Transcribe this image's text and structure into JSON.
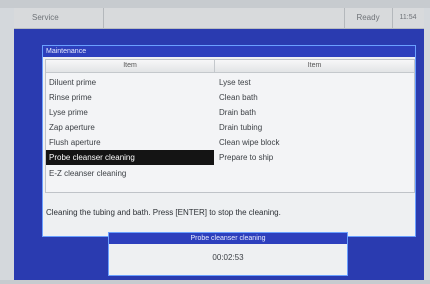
{
  "topbar": {
    "mode": "Service",
    "status": "Ready",
    "clock": "11:54"
  },
  "window": {
    "title": "Maintenance",
    "columns": [
      "Item",
      "Item"
    ],
    "left_items": [
      "Diluent prime",
      "Rinse prime",
      "Lyse prime",
      "Zap aperture",
      "Flush aperture",
      "Probe cleanser cleaning",
      "E-Z cleanser cleaning"
    ],
    "right_items": [
      "Lyse test",
      "Clean bath",
      "Drain bath",
      "Drain tubing",
      "Clean wipe block",
      "Prepare to ship"
    ],
    "selected": "Probe cleanser cleaning",
    "hint": "Cleaning the tubing and bath. Press [ENTER] to stop the cleaning."
  },
  "progress": {
    "title": "Probe cleanser cleaning",
    "elapsed": "00:02:53"
  }
}
